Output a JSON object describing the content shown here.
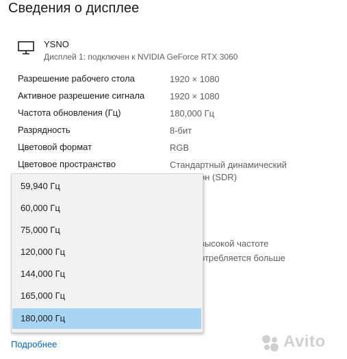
{
  "page": {
    "title": "Сведения о дисплее"
  },
  "display": {
    "name": "YSNO",
    "description": "Дисплей 1: подключен к NVIDIA GeForce RTX 3060",
    "icon": "monitor-icon"
  },
  "properties": [
    {
      "label": "Разрешение рабочего стола",
      "value": "1920 × 1080"
    },
    {
      "label": "Активное разрешение сигнала",
      "value": "1920 × 1080"
    },
    {
      "label": "Частота обновления (Гц)",
      "value": "180,000 Гц"
    },
    {
      "label": "Разрядность",
      "value": "8-бит"
    },
    {
      "label": "Цветовой формат",
      "value": "RGB"
    },
    {
      "label": "Цветовое пространство",
      "value": "Стандартный динамический",
      "value2": "он (SDR)"
    }
  ],
  "obscured_text": {
    "line1": "высокой частоте",
    "line2": "отребляется больше"
  },
  "refresh_dropdown": {
    "options": [
      "59,940 Гц",
      "60,000 Гц",
      "75,000 Гц",
      "120,000 Гц",
      "144,000 Гц",
      "165,000 Гц",
      "180,000 Гц"
    ],
    "selected": "180,000 Гц",
    "highlight_color": "#a8d4f4"
  },
  "link": {
    "label": "Подробнее",
    "color": "#0067c0"
  },
  "watermark": {
    "text": "Avito"
  }
}
